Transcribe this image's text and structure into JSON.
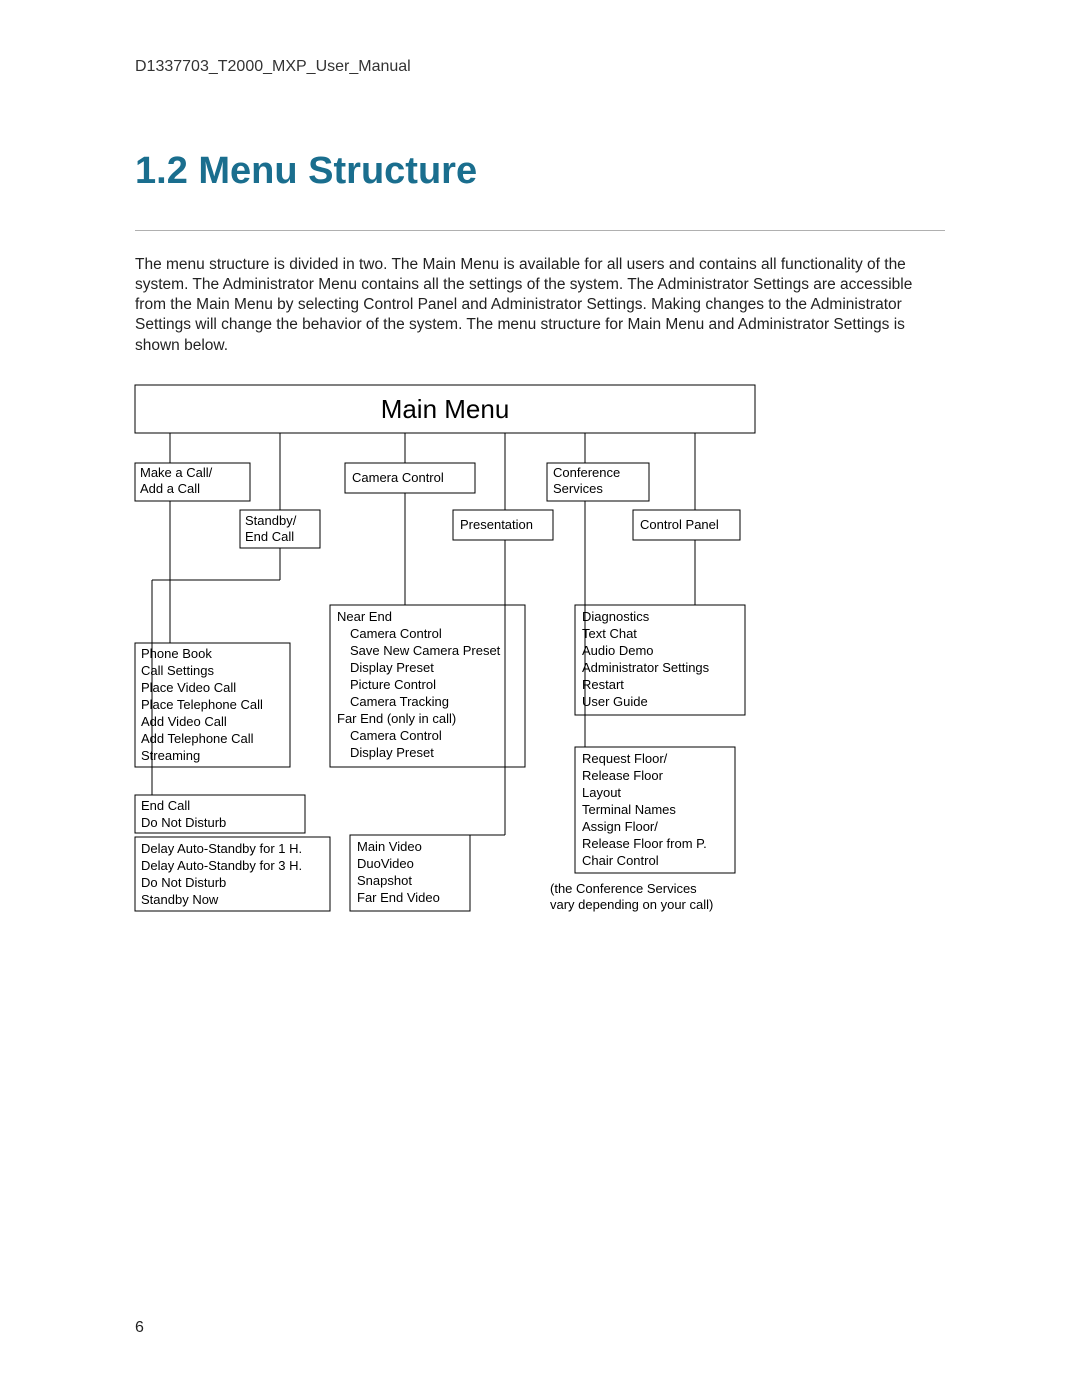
{
  "header": "D1337703_T2000_MXP_User_Manual",
  "section_title": "1.2 Menu Structure",
  "body_paragraph": "The menu structure is divided in two. The Main Menu is available for all users and contains all functionality of the system. The Administrator Menu contains all the settings of the system. The Administrator Settings are accessible from the Main Menu by selecting Control Panel and Administrator Settings. Making changes to the Administrator Settings will change the behavior of the system. The menu structure for Main Menu and Administrator Settings is shown below.",
  "page_number": "6",
  "diagram": {
    "root": "Main Menu",
    "level1": {
      "make_call": "Make a Call/",
      "make_call2": "Add a Call",
      "camera_control": "Camera Control",
      "conference1": "Conference",
      "conference2": "Services",
      "standby1": "Standby/",
      "standby2": "End Call",
      "presentation": "Presentation",
      "control_panel": "Control Panel"
    },
    "make_call_sub": {
      "l1": "Phone Book",
      "l2": "Call Settings",
      "l3": "Place Video Call",
      "l4": "Place Telephone Call",
      "l5": "Add Video Call",
      "l6": "Add Telephone Call",
      "l7": "Streaming"
    },
    "standby_sub1": {
      "l1": "End Call",
      "l2": "Do Not Disturb"
    },
    "standby_sub2": {
      "l1": "Delay Auto-Standby for 1 H.",
      "l2": "Delay Auto-Standby for 3 H.",
      "l3": "Do Not Disturb",
      "l4": "Standby Now"
    },
    "camera_sub": {
      "l1": "Near End",
      "l2": "Camera Control",
      "l3": "Save New Camera Preset",
      "l4": "Display Preset",
      "l5": "Picture Control",
      "l6": "Camera Tracking",
      "l7": "Far End (only in call)",
      "l8": "Camera Control",
      "l9": "Display Preset"
    },
    "presentation_sub": {
      "l1": "Main Video",
      "l2": "DuoVideo",
      "l3": "Snapshot",
      "l4": "Far End Video"
    },
    "control_panel_sub": {
      "l1": "Diagnostics",
      "l2": "Text Chat",
      "l3": "Audio Demo",
      "l4": "Administrator Settings",
      "l5": "Restart",
      "l6": "User Guide"
    },
    "conference_sub": {
      "l1": "Request Floor/",
      "l2": "Release Floor",
      "l3": "Layout",
      "l4": "Terminal Names",
      "l5": "Assign Floor/",
      "l6": "Release Floor from P.",
      "l7": "Chair Control"
    },
    "conference_note1": "(the Conference Services",
    "conference_note2": "vary depending on your call)"
  }
}
